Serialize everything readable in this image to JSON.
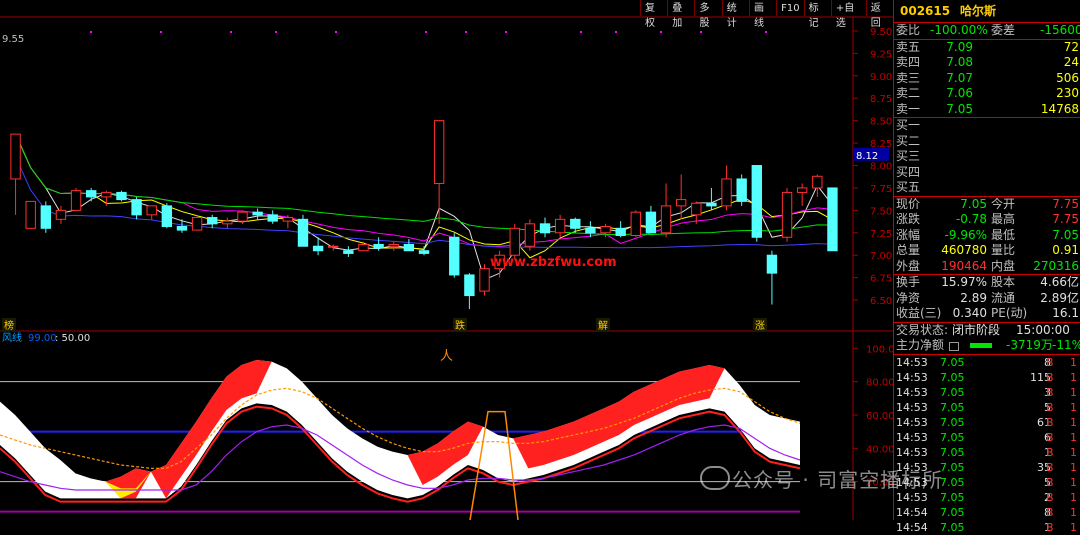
{
  "toolbar": [
    "复权",
    "叠加",
    "多股",
    "统计",
    "画线",
    "F10",
    "标记",
    "+自选",
    "返回"
  ],
  "chart": {
    "top_left_value": "9.55",
    "price_ticks": [
      "9.50",
      "9.25",
      "9.00",
      "8.75",
      "8.50",
      "8.25",
      "8.00",
      "7.75",
      "7.50",
      "7.25",
      "7.00",
      "6.75",
      "6.50"
    ],
    "current_price_tag": "8.12",
    "website": "www.zbzfwu.com",
    "event_labels": [
      {
        "text": "榜",
        "date_index": 0
      },
      {
        "text": "跌",
        "date_index": 1
      },
      {
        "text": "解",
        "date_index": 2
      },
      {
        "text": "涨",
        "date_index": 3
      }
    ],
    "indicator_header_name": "风线",
    "indicator_header_a": "99.00",
    "indicator_header_b": ": 50.00",
    "indicator_ticks": [
      "100.0",
      "80.00",
      "60.00",
      "40.00",
      "20.00"
    ],
    "buy_label": "买"
  },
  "chart_data": {
    "type": "candlestick",
    "price_range": [
      6.3,
      9.6
    ],
    "indicator_range": [
      0,
      105
    ],
    "candles": [
      {
        "o": 7.85,
        "h": 8.2,
        "l": 7.45,
        "c": 8.35
      },
      {
        "o": 7.3,
        "h": 7.6,
        "l": 7.3,
        "c": 7.6
      },
      {
        "o": 7.55,
        "h": 7.6,
        "l": 7.25,
        "c": 7.3
      },
      {
        "o": 7.4,
        "h": 7.55,
        "l": 7.35,
        "c": 7.5
      },
      {
        "o": 7.5,
        "h": 7.75,
        "l": 7.5,
        "c": 7.72
      },
      {
        "o": 7.72,
        "h": 7.75,
        "l": 7.6,
        "c": 7.65
      },
      {
        "o": 7.65,
        "h": 7.72,
        "l": 7.55,
        "c": 7.7
      },
      {
        "o": 7.7,
        "h": 7.72,
        "l": 7.6,
        "c": 7.62
      },
      {
        "o": 7.62,
        "h": 7.65,
        "l": 7.4,
        "c": 7.45
      },
      {
        "o": 7.45,
        "h": 7.55,
        "l": 7.4,
        "c": 7.55
      },
      {
        "o": 7.55,
        "h": 7.58,
        "l": 7.3,
        "c": 7.32
      },
      {
        "o": 7.32,
        "h": 7.4,
        "l": 7.25,
        "c": 7.28
      },
      {
        "o": 7.28,
        "h": 7.45,
        "l": 7.28,
        "c": 7.42
      },
      {
        "o": 7.42,
        "h": 7.45,
        "l": 7.3,
        "c": 7.35
      },
      {
        "o": 7.35,
        "h": 7.42,
        "l": 7.3,
        "c": 7.38
      },
      {
        "o": 7.38,
        "h": 7.5,
        "l": 7.35,
        "c": 7.48
      },
      {
        "o": 7.48,
        "h": 7.52,
        "l": 7.4,
        "c": 7.45
      },
      {
        "o": 7.45,
        "h": 7.5,
        "l": 7.35,
        "c": 7.38
      },
      {
        "o": 7.38,
        "h": 7.45,
        "l": 7.3,
        "c": 7.42
      },
      {
        "o": 7.4,
        "h": 7.45,
        "l": 7.1,
        "c": 7.1
      },
      {
        "o": 7.1,
        "h": 7.2,
        "l": 7.0,
        "c": 7.05
      },
      {
        "o": 7.1,
        "h": 7.12,
        "l": 7.05,
        "c": 7.1
      },
      {
        "o": 7.05,
        "h": 7.1,
        "l": 6.98,
        "c": 7.02
      },
      {
        "o": 7.05,
        "h": 7.15,
        "l": 7.05,
        "c": 7.12
      },
      {
        "o": 7.12,
        "h": 7.2,
        "l": 7.05,
        "c": 7.08
      },
      {
        "o": 7.1,
        "h": 7.15,
        "l": 7.05,
        "c": 7.12
      },
      {
        "o": 7.12,
        "h": 7.18,
        "l": 7.05,
        "c": 7.05
      },
      {
        "o": 7.05,
        "h": 7.1,
        "l": 7.0,
        "c": 7.02
      },
      {
        "o": 7.8,
        "h": 8.5,
        "l": 7.35,
        "c": 8.5
      },
      {
        "o": 7.2,
        "h": 7.25,
        "l": 6.75,
        "c": 6.78
      },
      {
        "o": 6.78,
        "h": 6.8,
        "l": 6.4,
        "c": 6.55
      },
      {
        "o": 6.6,
        "h": 6.9,
        "l": 6.55,
        "c": 6.85
      },
      {
        "o": 6.85,
        "h": 7.05,
        "l": 6.75,
        "c": 7.0
      },
      {
        "o": 7.0,
        "h": 7.35,
        "l": 6.95,
        "c": 7.3
      },
      {
        "o": 7.1,
        "h": 7.4,
        "l": 7.05,
        "c": 7.35
      },
      {
        "o": 7.35,
        "h": 7.42,
        "l": 7.2,
        "c": 7.25
      },
      {
        "o": 7.25,
        "h": 7.45,
        "l": 7.2,
        "c": 7.4
      },
      {
        "o": 7.4,
        "h": 7.42,
        "l": 7.25,
        "c": 7.3
      },
      {
        "o": 7.3,
        "h": 7.38,
        "l": 7.2,
        "c": 7.25
      },
      {
        "o": 7.25,
        "h": 7.35,
        "l": 7.2,
        "c": 7.32
      },
      {
        "o": 7.3,
        "h": 7.38,
        "l": 7.2,
        "c": 7.22
      },
      {
        "o": 7.22,
        "h": 7.5,
        "l": 7.2,
        "c": 7.48
      },
      {
        "o": 7.48,
        "h": 7.55,
        "l": 7.25,
        "c": 7.25
      },
      {
        "o": 7.25,
        "h": 7.8,
        "l": 7.2,
        "c": 7.55
      },
      {
        "o": 7.55,
        "h": 7.9,
        "l": 7.4,
        "c": 7.62
      },
      {
        "o": 7.45,
        "h": 7.6,
        "l": 7.35,
        "c": 7.58
      },
      {
        "o": 7.58,
        "h": 7.75,
        "l": 7.5,
        "c": 7.55
      },
      {
        "o": 7.55,
        "h": 8.0,
        "l": 7.5,
        "c": 7.85
      },
      {
        "o": 7.85,
        "h": 7.9,
        "l": 7.55,
        "c": 7.6
      },
      {
        "o": 8.0,
        "h": 8.0,
        "l": 7.15,
        "c": 7.2
      },
      {
        "o": 7.0,
        "h": 7.05,
        "l": 6.45,
        "c": 6.8
      },
      {
        "o": 7.2,
        "h": 7.75,
        "l": 7.15,
        "c": 7.7
      },
      {
        "o": 7.7,
        "h": 7.8,
        "l": 7.55,
        "c": 7.75
      },
      {
        "o": 7.75,
        "h": 7.9,
        "l": 7.65,
        "c": 7.88
      },
      {
        "o": 7.75,
        "h": 7.75,
        "l": 7.05,
        "c": 7.05
      }
    ],
    "k_line": [
      60,
      52,
      42,
      32,
      25,
      17,
      14,
      12,
      15,
      20,
      18,
      22,
      35,
      48,
      62,
      75,
      82,
      85,
      84,
      80,
      72,
      62,
      52,
      44,
      38,
      33,
      30,
      28,
      30,
      35,
      42,
      48,
      45,
      40,
      38,
      40,
      42,
      45,
      48,
      52,
      56,
      60,
      66,
      70,
      74,
      78,
      80,
      82,
      80,
      70,
      58,
      52,
      50,
      48
    ],
    "d_line": [
      48,
      45,
      42,
      40,
      38,
      36,
      34,
      32,
      30,
      29,
      28,
      28,
      32,
      40,
      48,
      58,
      66,
      72,
      75,
      76,
      74,
      70,
      64,
      58,
      52,
      47,
      43,
      40,
      38,
      38,
      40,
      43,
      44,
      44,
      43,
      43,
      44,
      46,
      48,
      50,
      52,
      55,
      58,
      62,
      66,
      70,
      73,
      75,
      76,
      74,
      68,
      62,
      58,
      55
    ]
  },
  "panel": {
    "code": "002615",
    "name": "哈尔斯",
    "weibi_label": "委比",
    "weibi": "-100.00%",
    "weicha_label": "委差",
    "weicha": "-15600",
    "asks": [
      {
        "label": "卖五",
        "price": "7.09",
        "vol": "72"
      },
      {
        "label": "卖四",
        "price": "7.08",
        "vol": "24"
      },
      {
        "label": "卖三",
        "price": "7.07",
        "vol": "506"
      },
      {
        "label": "卖二",
        "price": "7.06",
        "vol": "230"
      },
      {
        "label": "卖一",
        "price": "7.05",
        "vol": "14768"
      }
    ],
    "bids": [
      "买一",
      "买二",
      "买三",
      "买四",
      "买五"
    ],
    "quote": [
      {
        "l1": "现价",
        "v1": "7.05",
        "l2": "今开",
        "v2": "7.75",
        "c1": "green",
        "c2": "red"
      },
      {
        "l1": "涨跌",
        "v1": "-0.78",
        "l2": "最高",
        "v2": "7.75",
        "c1": "green",
        "c2": "red"
      },
      {
        "l1": "涨幅",
        "v1": "-9.96%",
        "l2": "最低",
        "v2": "7.05",
        "c1": "green",
        "c2": "green"
      },
      {
        "l1": "总量",
        "v1": "460780",
        "l2": "量比",
        "v2": "0.91",
        "c1": "yellow",
        "c2": "yellow"
      },
      {
        "l1": "外盘",
        "v1": "190464",
        "l2": "内盘",
        "v2": "270316",
        "c1": "red",
        "c2": "green"
      }
    ],
    "stats": [
      {
        "l1": "换手",
        "v1": "15.97%",
        "l2": "股本",
        "v2": "4.66亿"
      },
      {
        "l1": "净资",
        "v1": "2.89",
        "l2": "流通",
        "v2": "2.89亿"
      },
      {
        "l1": "收益(三)",
        "v1": "0.340",
        "l2": "PE(动)",
        "v2": "16.1"
      }
    ],
    "trade_status_label": "交易状态:",
    "trade_status_value": "闭市阶段",
    "trade_status_time": "15:00:00",
    "main_flow_label": "主力净额",
    "main_flow_value": "-3719万",
    "main_flow_pct": "-11%",
    "trades": [
      {
        "t": "14:53",
        "p": "7.05",
        "v": "8",
        "d": "B"
      },
      {
        "t": "14:53",
        "p": "7.05",
        "v": "115",
        "d": "B"
      },
      {
        "t": "14:53",
        "p": "7.05",
        "v": "3",
        "d": "B"
      },
      {
        "t": "14:53",
        "p": "7.05",
        "v": "5",
        "d": "B"
      },
      {
        "t": "14:53",
        "p": "7.05",
        "v": "61",
        "d": "B"
      },
      {
        "t": "14:53",
        "p": "7.05",
        "v": "6",
        "d": "B"
      },
      {
        "t": "14:53",
        "p": "7.05",
        "v": "1",
        "d": "B"
      },
      {
        "t": "14:53",
        "p": "7.05",
        "v": "35",
        "d": "B"
      },
      {
        "t": "14:53",
        "p": "7.05",
        "v": "5",
        "d": "B"
      },
      {
        "t": "14:53",
        "p": "7.05",
        "v": "2",
        "d": "B"
      },
      {
        "t": "14:54",
        "p": "7.05",
        "v": "8",
        "d": "B"
      },
      {
        "t": "14:54",
        "p": "7.05",
        "v": "1",
        "d": "B"
      }
    ],
    "trade_extra": "1"
  },
  "watermark": "公众号 · 司富空播标所"
}
